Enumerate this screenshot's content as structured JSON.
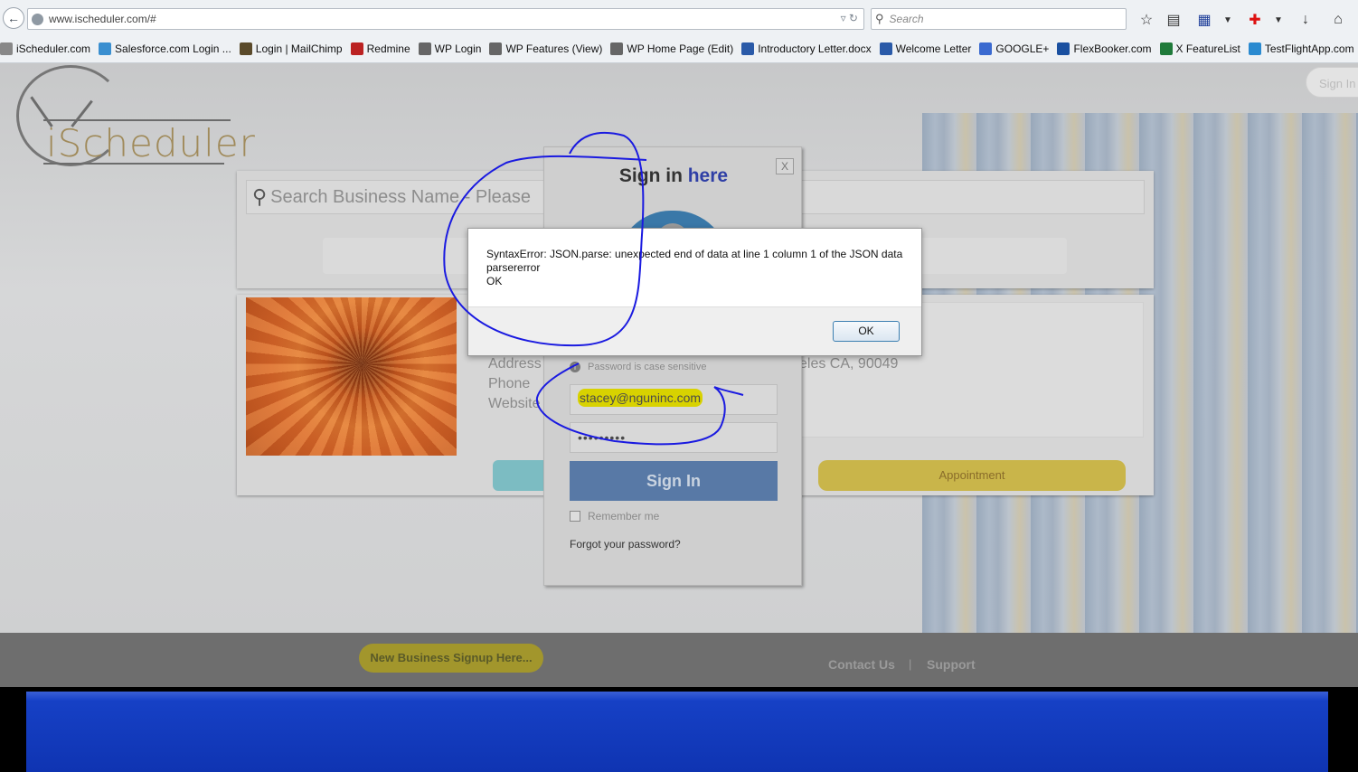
{
  "browser": {
    "url": "www.ischeduler.com/#",
    "search_placeholder": "Search",
    "bookmarks": [
      {
        "label": "iScheduler.com",
        "icon": "clock-icon"
      },
      {
        "label": "Salesforce.com Login ...",
        "icon": "cloud-icon"
      },
      {
        "label": "Login | MailChimp",
        "icon": "mailchimp-icon"
      },
      {
        "label": "Redmine",
        "icon": "redmine-icon"
      },
      {
        "label": "WP Login",
        "icon": "wordpress-icon"
      },
      {
        "label": "WP Features (View)",
        "icon": "wordpress-icon"
      },
      {
        "label": "WP Home Page (Edit)",
        "icon": "wordpress-icon"
      },
      {
        "label": "Introductory Letter.docx",
        "icon": "word-icon"
      },
      {
        "label": "Welcome Letter",
        "icon": "word-icon"
      },
      {
        "label": "GOOGLE+",
        "icon": "google-plus-icon"
      },
      {
        "label": "FlexBooker.com",
        "icon": "flexbooker-icon"
      },
      {
        "label": "X FeatureList",
        "icon": "excel-icon"
      },
      {
        "label": "TestFlightApp.com",
        "icon": "testflight-icon"
      }
    ]
  },
  "site": {
    "logo_text": "iScheduler",
    "header_signin": "Sign In",
    "search_placeholder": "Search Business Name - Please",
    "business": {
      "address_label": "Address",
      "address_tail": "eles CA, 90049",
      "phone_label": "Phone",
      "website_label": "Website"
    },
    "appointment_label": "Appointment"
  },
  "login": {
    "close_label": "X",
    "title_prefix": "Sign in ",
    "title_here": "here",
    "password_note": "Password is case sensitive",
    "email_value": "stacey@nguninc.com",
    "password_mask": "•••••••••",
    "signin_label": "Sign In",
    "remember_label": "Remember me",
    "forgot_label": "Forgot your password?"
  },
  "alert": {
    "line1": "SyntaxError: JSON.parse: unexpected end of data at line 1 column 1 of the JSON data",
    "line2": "parsererror",
    "line3": "OK",
    "ok_label": "OK"
  },
  "footer": {
    "new_business_label": "New Business Signup Here...",
    "contact_label": "Contact Us",
    "separator": "|",
    "support_label": "Support"
  },
  "colors": {
    "annotation_ink": "#1a1ae0",
    "highlight": "#e8e000",
    "link_blue": "#2f3fa6"
  }
}
